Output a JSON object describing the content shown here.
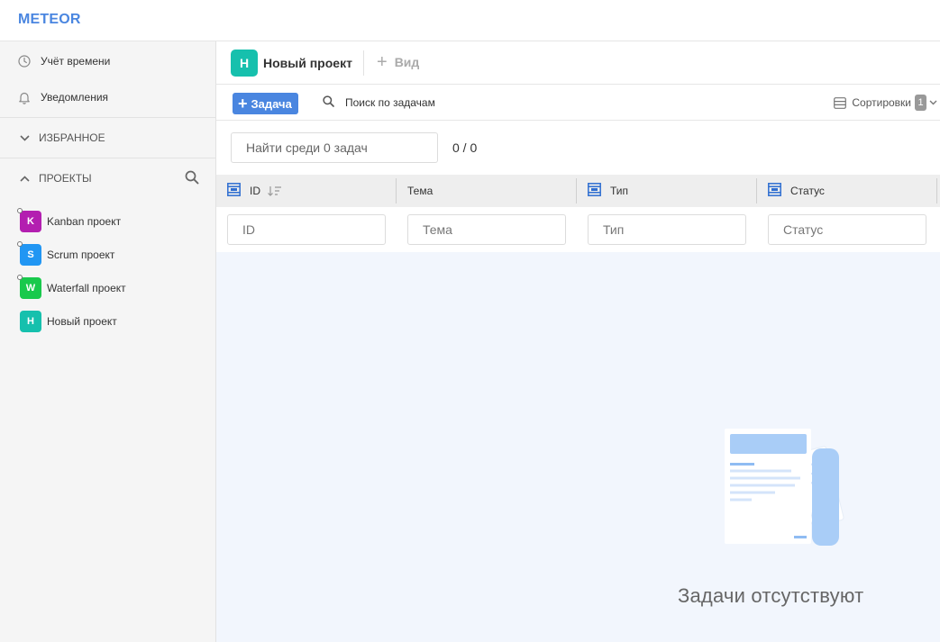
{
  "app": {
    "logo": "METEOR"
  },
  "sidebar": {
    "nav": [
      {
        "label": "Учёт времени",
        "icon": "clock-icon"
      },
      {
        "label": "Уведомления",
        "icon": "bell-icon"
      }
    ],
    "favorites_label": "ИЗБРАННОЕ",
    "projects_label": "ПРОЕКТЫ",
    "projects": [
      {
        "letter": "K",
        "name": "Kanban проект",
        "color": "#b31fb0"
      },
      {
        "letter": "S",
        "name": "Scrum проект",
        "color": "#2196f3"
      },
      {
        "letter": "W",
        "name": "Waterfall проект",
        "color": "#19c94c"
      },
      {
        "letter": "Н",
        "name": "Новый проект",
        "color": "#16c0ad"
      }
    ]
  },
  "header": {
    "project_letter": "Н",
    "project_title": "Новый проект",
    "add_view_label": "Вид"
  },
  "toolbar": {
    "task_button": "Задача",
    "search_label": "Поиск по задачам",
    "sort_label": "Сортировки",
    "sort_count": "1"
  },
  "filter": {
    "find_placeholder": "Найти среди 0 задач",
    "counter": "0 / 0"
  },
  "table": {
    "columns": [
      "ID",
      "Тема",
      "Тип",
      "Статус"
    ],
    "filter_placeholders": [
      "ID",
      "Тема",
      "Тип",
      "Статус"
    ]
  },
  "empty": {
    "message": "Задачи отсутствуют"
  },
  "colors": {
    "accent": "#4a86e0",
    "project_badge": "#16c0ad",
    "empty_bg": "#f2f6fd"
  }
}
